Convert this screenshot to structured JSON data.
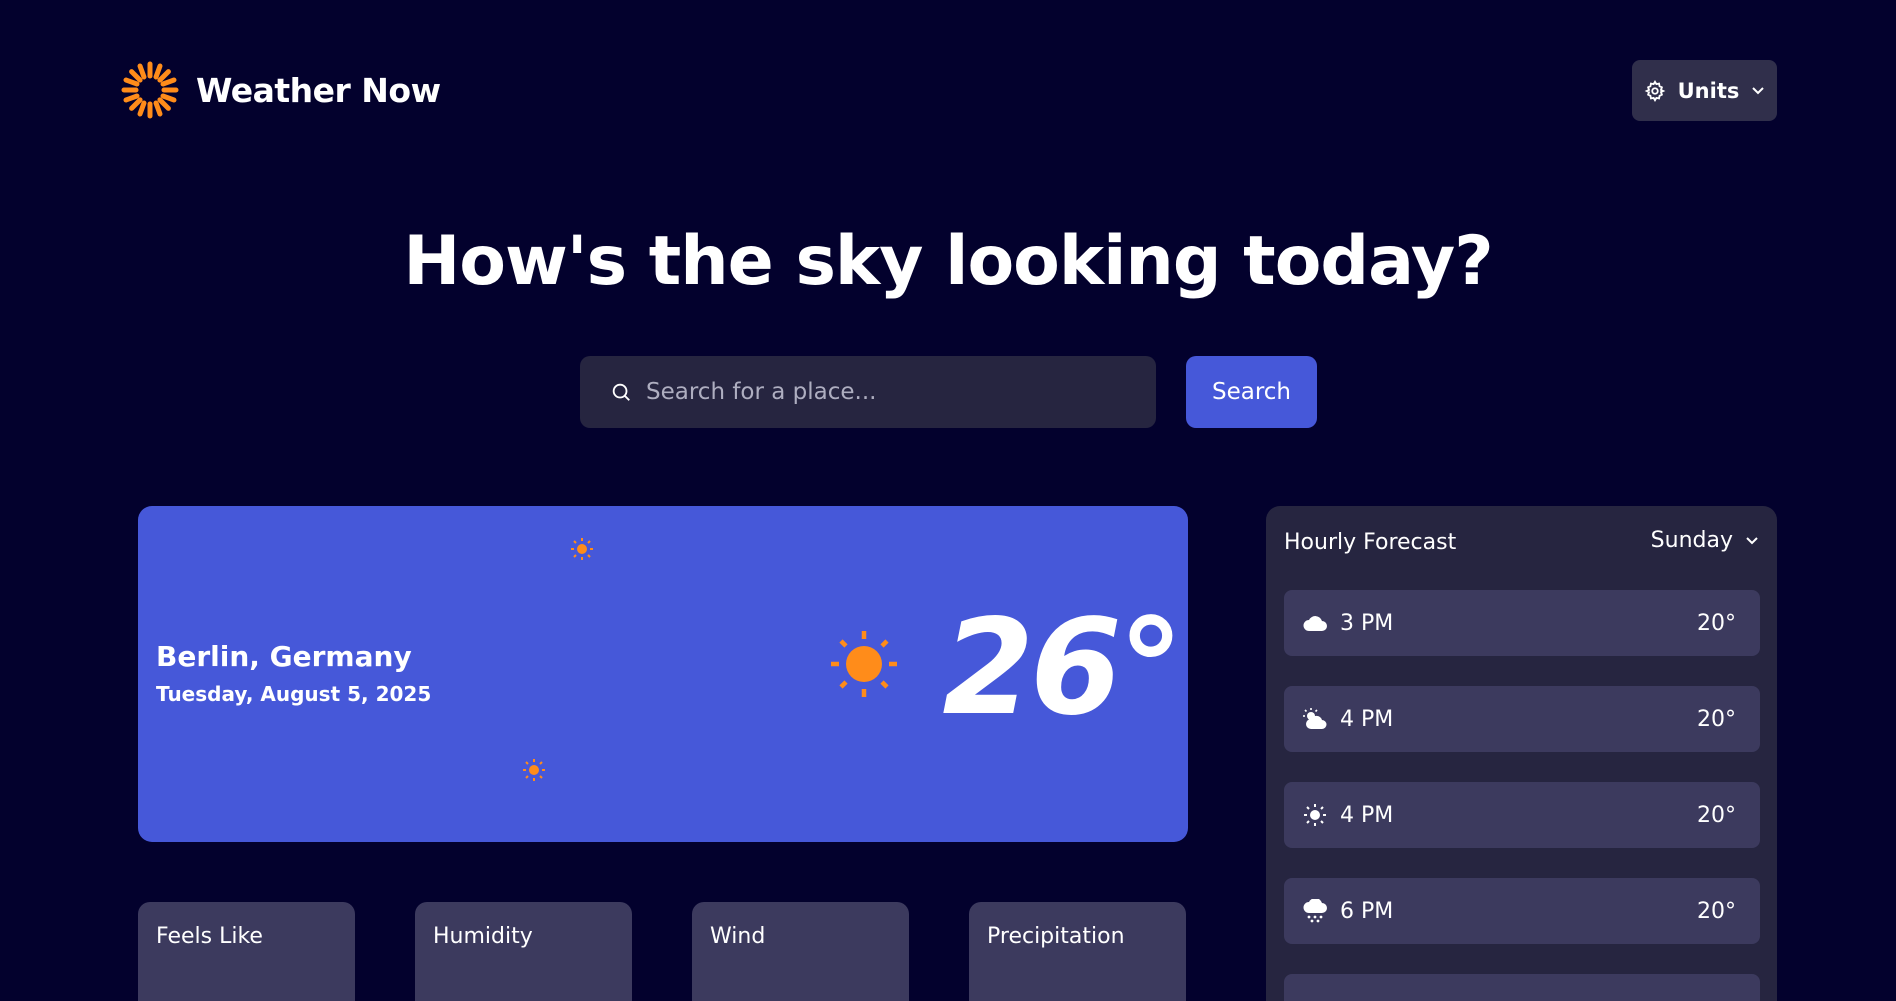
{
  "app": {
    "title": "Weather Now",
    "accent": "#4658d9",
    "sun_color": "#ff8c1a"
  },
  "header": {
    "units_label": "Units"
  },
  "hero": {
    "headline": "How's the sky looking today?"
  },
  "search": {
    "placeholder": "Search for a place...",
    "button_label": "Search"
  },
  "current": {
    "location": "Berlin, Germany",
    "date": "Tuesday, August 5, 2025",
    "temperature": "26°",
    "icon": "sun-icon"
  },
  "stats": [
    {
      "label": "Feels Like"
    },
    {
      "label": "Humidity"
    },
    {
      "label": "Wind"
    },
    {
      "label": "Precipitation"
    }
  ],
  "hourly": {
    "title": "Hourly Forecast",
    "day": "Sunday",
    "items": [
      {
        "icon": "cloud-icon",
        "time": "3 PM",
        "temp": "20°"
      },
      {
        "icon": "partly-cloudy-icon",
        "time": "4 PM",
        "temp": "20°"
      },
      {
        "icon": "sun-icon",
        "time": "4 PM",
        "temp": "20°"
      },
      {
        "icon": "snow-cloud-icon",
        "time": "6 PM",
        "temp": "20°"
      }
    ]
  }
}
